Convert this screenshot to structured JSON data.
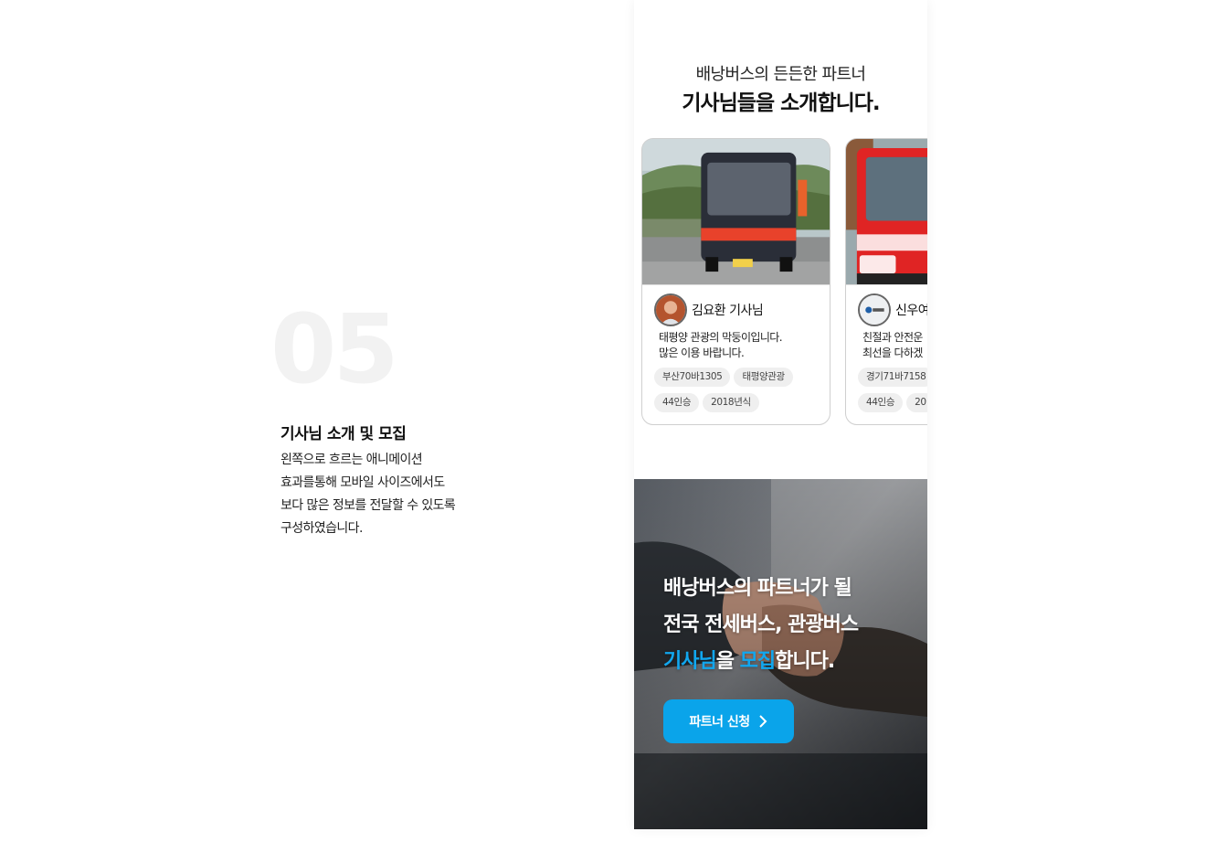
{
  "section": {
    "number": "05",
    "title": "기사님 소개 및 모집",
    "description": [
      "왼쪽으로 흐르는 애니메이션",
      "효과를통해 모바일 사이즈에서도",
      "보다 많은 정보를 전달할 수 있도록",
      "구성하였습니다."
    ]
  },
  "intro": {
    "subtitle": "배낭버스의 든든한 파트너",
    "title": "기사님들을 소개합니다."
  },
  "drivers": [
    {
      "name": "김요환 기사님",
      "description": [
        "태평양 관광의 막둥이입니다.",
        "많은 이용 바랍니다."
      ],
      "tags": [
        "부산70바1305",
        "태평양관광",
        "44인승",
        "2018년식"
      ],
      "bus_color": "#2a2e38",
      "bus_stripe": "#e8422b"
    },
    {
      "name": "신우여",
      "description": [
        "친절과 안전운",
        "최선을 다하겠"
      ],
      "tags": [
        "경기71바7158",
        "44인승",
        "20"
      ],
      "bus_color": "#e02424",
      "bus_stripe": "#ffffff"
    }
  ],
  "recruit": {
    "line1": "배낭버스의 파트너가 될",
    "line2": "전국 전세버스, 관광버스",
    "line3_accent1": "기사님",
    "line3_text1": "을 ",
    "line3_accent2": "모집",
    "line3_text2": "합니다.",
    "button_label": "파트너 신청",
    "accent_color": "#11a7ef"
  }
}
